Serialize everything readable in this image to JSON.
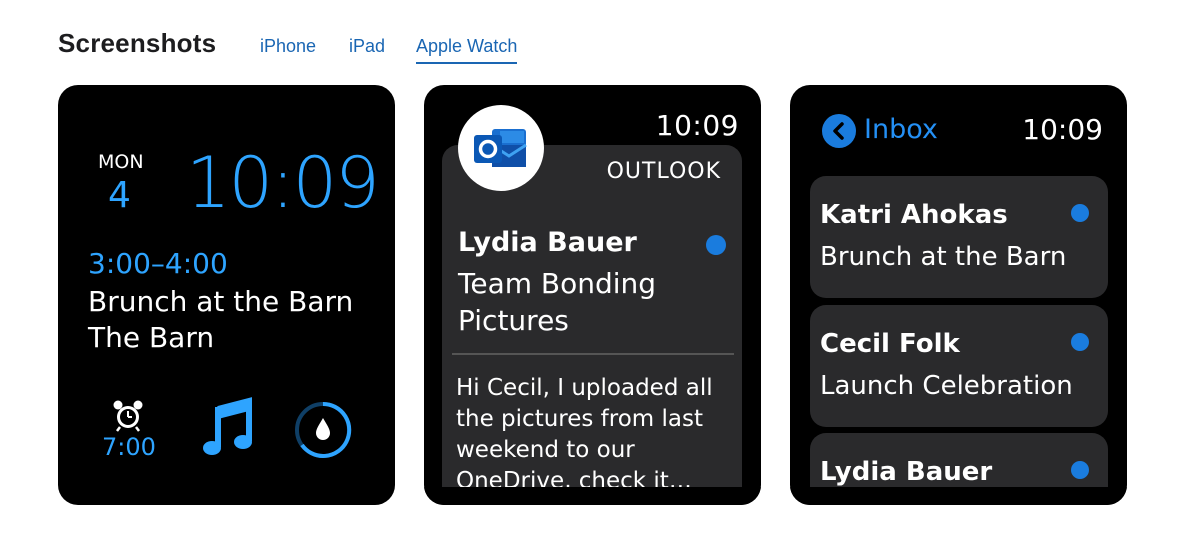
{
  "header": {
    "title": "Screenshots",
    "tabs": [
      {
        "label": "iPhone",
        "active": false
      },
      {
        "label": "iPad",
        "active": false
      },
      {
        "label": "Apple Watch",
        "active": true
      }
    ]
  },
  "watch1": {
    "day": "MON",
    "date": "4",
    "time": "10:09",
    "event_time": "3:00–4:00",
    "event_title": "Brunch at the Barn",
    "event_location": "The Barn",
    "alarm_time": "7:00",
    "icons": [
      "alarm-clock-icon",
      "music-note-icon",
      "water-drop-ring-icon"
    ]
  },
  "watch2": {
    "clock": "10:09",
    "app_name": "OUTLOOK",
    "sender": "Lydia Bauer",
    "subject": "Team Bonding Pictures",
    "preview": "Hi Cecil, I uploaded all the pictures from last weekend to our OneDrive, check it…",
    "icons": [
      "outlook-logo-icon",
      "unread-dot-icon"
    ]
  },
  "watch3": {
    "back_label": "Inbox",
    "clock": "10:09",
    "messages": [
      {
        "sender": "Katri Ahokas",
        "subject": "Brunch at the Barn"
      },
      {
        "sender": "Cecil Folk",
        "subject": "Launch Celebration"
      },
      {
        "sender": "Lydia Bauer",
        "subject": ""
      }
    ],
    "icons": [
      "back-chevron-icon",
      "unread-dot-icon"
    ]
  },
  "colors": {
    "accent_blue": "#2ea4ff",
    "link_blue": "#1a66b3",
    "unread_dot": "#1a7cde",
    "card_bg": "#2a2a2c"
  }
}
